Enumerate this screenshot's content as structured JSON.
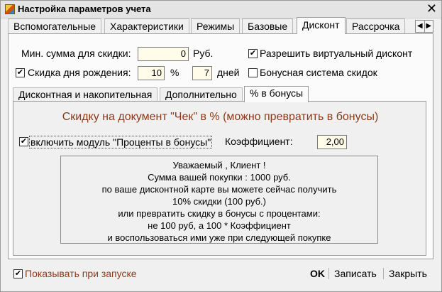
{
  "window": {
    "title": "Настройка параметров учета",
    "close_icon": "close-icon"
  },
  "tabs": [
    "Вспомогательные",
    "Характеристики",
    "Режимы",
    "Базовые",
    "Дисконт",
    "Рассрочка"
  ],
  "tab_scroll": {
    "left": "◀",
    "right": "▶"
  },
  "discount": {
    "min_sum_label": "Мин. сумма для скидки:",
    "min_sum_value": "0",
    "currency": "Руб.",
    "virtual_discount_label": "Разрешить виртуальный дисконт",
    "virtual_discount_checked": true,
    "birthday_label": "Скидка дня рождения:",
    "birthday_checked": true,
    "birthday_percent": "10",
    "percent_sign": "%",
    "birthday_days": "7",
    "days_label": "дней",
    "bonus_system_label": "Бонусная система скидок",
    "bonus_system_checked": false
  },
  "subtabs": [
    "Дисконтная и накопительная",
    "Дополнительно",
    "% в бонусы"
  ],
  "bonus": {
    "heading": "Скидку на документ \"Чек\" в % (можно превратить в бонусы)",
    "module_label": "включить модуль \"Проценты в бонусы\"",
    "module_checked": true,
    "coef_label": "Коэффициент:",
    "coef_value": "2,00",
    "message": [
      "Уважаемый , Клиент !",
      "Сумма вашей покупки : 1000 руб.",
      "по ваше дисконтной карте вы можете сейчас получить",
      "10% скидки (100 руб.)",
      "или превратить скидку  в бонусы с процентами:",
      "не 100 руб, а 100 * Коэффициент",
      "и воспользоваться ими уже при следующей покупке"
    ]
  },
  "footer": {
    "show_on_start_label": "Показывать при запуске",
    "show_on_start_checked": true,
    "ok": "OK",
    "save": "Записать",
    "close": "Закрыть"
  },
  "colors": {
    "heading": "#8b3a1a",
    "input_bg": "#fffde9"
  }
}
